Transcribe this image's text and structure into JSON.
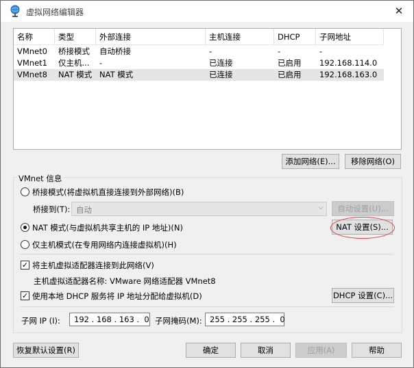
{
  "window": {
    "title": "虚拟网络编辑器",
    "close_glyph": "✕"
  },
  "list": {
    "columns": [
      "名称",
      "类型",
      "外部连接",
      "主机连接",
      "DHCP",
      "子网地址"
    ],
    "rows": [
      [
        "VMnet0",
        "桥接模式",
        "自动桥接",
        "-",
        "-",
        "-"
      ],
      [
        "VMnet1",
        "仅主机...",
        "-",
        "已连接",
        "已启用",
        "192.168.114.0"
      ],
      [
        "VMnet8",
        "NAT 模式",
        "NAT 模式",
        "已连接",
        "已启用",
        "192.168.163.0"
      ]
    ],
    "selected_row": 2
  },
  "list_buttons": {
    "add": "添加网络(E)...",
    "remove": "移除网络(O)"
  },
  "vmnet_info": {
    "legend": "VMnet 信息",
    "bridged_label": "桥接模式(将虚拟机直接连接到外部网络)(B)",
    "bridge_to_label": "桥接到(T):",
    "bridge_to_value": "自动",
    "auto_settings": "自动设置(U)...",
    "nat_label": "NAT 模式(与虚拟机共享主机的 IP 地址)(N)",
    "nat_settings": "NAT 设置(S)...",
    "hostonly_label": "仅主机模式(在专用网络内连接虚拟机)(H)",
    "connect_adapter_label": "将主机虚拟适配器连接到此网络(V)",
    "adapter_name_text": "主机虚拟适配器名称: VMware 网络适配器 VMnet8",
    "dhcp_label": "使用本地 DHCP 服务将 IP 地址分配给虚拟机(D)",
    "dhcp_settings": "DHCP 设置(C)...",
    "subnet_ip_label": "子网 IP (I):",
    "subnet_ip": "192 . 168 . 163 .  0",
    "subnet_mask_label": "子网掩码(M):",
    "subnet_mask": "255 . 255 . 255 .  0",
    "selected_mode": "nat",
    "connect_adapter_checked": true,
    "dhcp_checked": true
  },
  "footer": {
    "restore": "恢复默认设置(R)",
    "ok": "确定",
    "cancel": "取消",
    "apply": "应用(A)",
    "help": "帮助"
  },
  "colors": {
    "selection_row": "#e5e5e5",
    "annotation_ellipse": "#e0413a"
  }
}
